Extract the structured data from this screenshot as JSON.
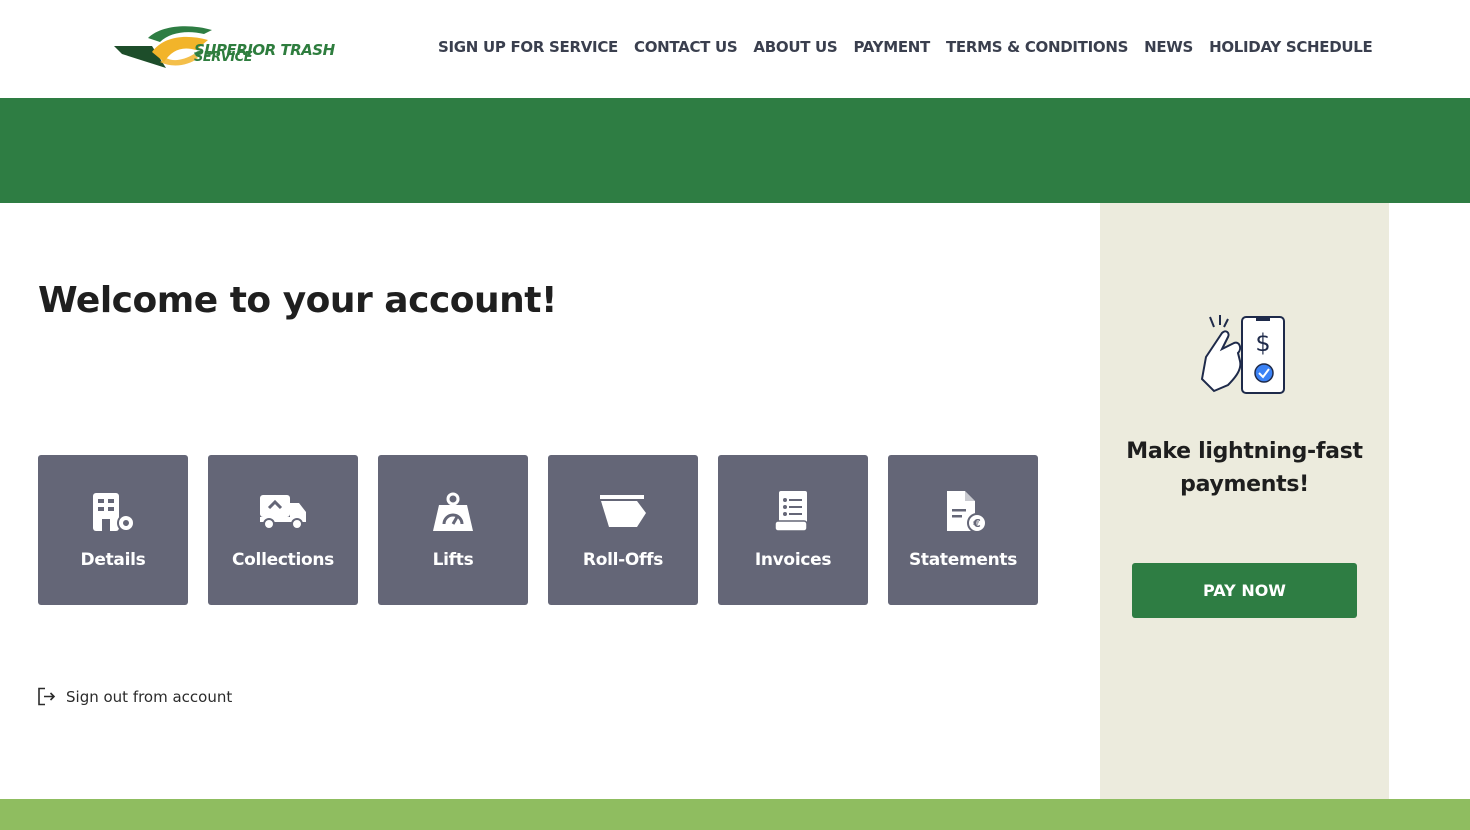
{
  "brand": {
    "name_line1": "SUPERIOR TRASH",
    "name_line2": "SERVICE",
    "colors": {
      "green": "#2e7d43",
      "gold": "#f2b42a",
      "dark_green": "#1d4d2a"
    }
  },
  "nav": {
    "items": [
      {
        "label": "SIGN UP FOR SERVICE"
      },
      {
        "label": "CONTACT US"
      },
      {
        "label": "ABOUT US"
      },
      {
        "label": "PAYMENT"
      },
      {
        "label": "TERMS & CONDITIONS"
      },
      {
        "label": "NEWS"
      },
      {
        "label": "HOLIDAY SCHEDULE"
      }
    ]
  },
  "main": {
    "title": "Welcome to your account!",
    "tiles": [
      {
        "label": "Details",
        "icon": "building-gear-icon"
      },
      {
        "label": "Collections",
        "icon": "truck-icon"
      },
      {
        "label": "Lifts",
        "icon": "weight-icon"
      },
      {
        "label": "Roll-Offs",
        "icon": "dumpster-icon"
      },
      {
        "label": "Invoices",
        "icon": "receipt-icon"
      },
      {
        "label": "Statements",
        "icon": "document-euro-icon"
      }
    ],
    "sign_out": "Sign out from account"
  },
  "side": {
    "promo": "Make lightning-fast payments!",
    "button": "PAY NOW",
    "illustration": "phone-payment-icon"
  },
  "colors": {
    "tile_bg": "#646677",
    "panel_bg": "#ecebdd",
    "footer": "#8fbd60",
    "accent_blue": "#3b82f6"
  }
}
